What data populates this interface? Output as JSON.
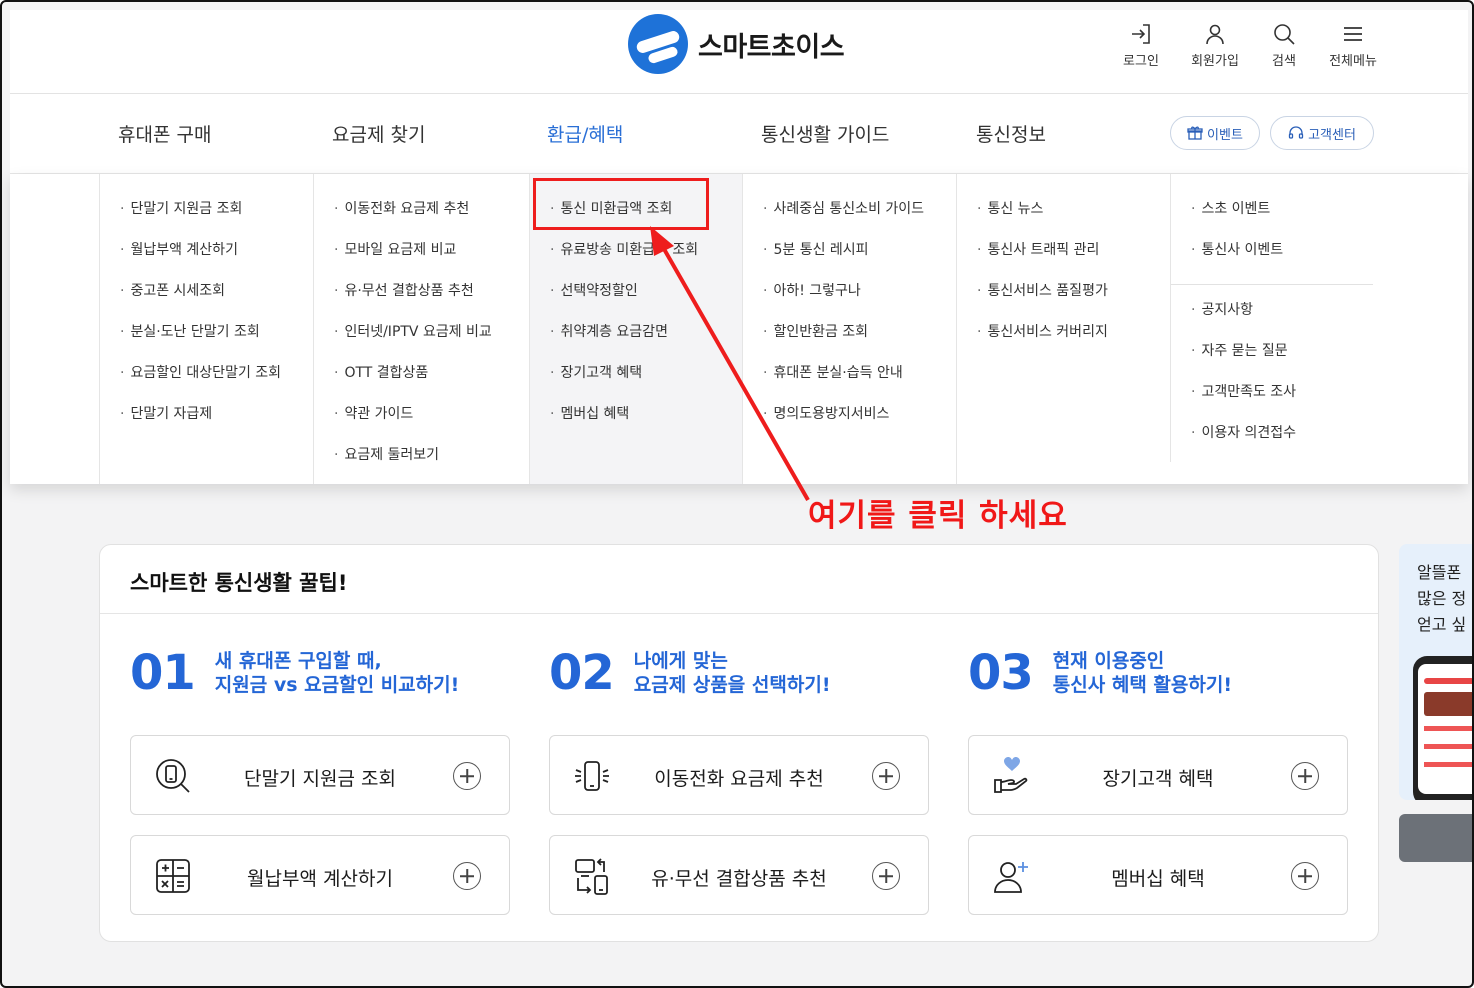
{
  "colors": {
    "accent": "#2466d6",
    "annotation": "#ee1d1d",
    "logo": "#1e72d8"
  },
  "header": {
    "logo_text": "스마트초이스",
    "utils": [
      {
        "label": "로그인",
        "icon": "login-icon"
      },
      {
        "label": "회원가입",
        "icon": "user-icon"
      },
      {
        "label": "검색",
        "icon": "search-icon"
      },
      {
        "label": "전체메뉴",
        "icon": "menu-icon"
      }
    ]
  },
  "gnb": {
    "items": [
      "휴대폰 구매",
      "요금제 찾기",
      "환급/혜택",
      "통신생활 가이드",
      "통신정보"
    ],
    "active": "환급/혜택",
    "event_label": "이벤트",
    "support_label": "고객센터"
  },
  "dropdown": {
    "col1": [
      "단말기 지원금 조회",
      "월납부액 계산하기",
      "중고폰 시세조회",
      "분실·도난 단말기 조회",
      "요금할인 대상단말기 조회",
      "단말기 자급제"
    ],
    "col2": [
      "이동전화 요금제 추천",
      "모바일 요금제 비교",
      "유·무선 결합상품 추천",
      "인터넷/IPTV 요금제 비교",
      "OTT 결합상품",
      "약관 가이드",
      "요금제 둘러보기"
    ],
    "col3": [
      "통신 미환급액 조회",
      "유료방송 미환급액 조회",
      "선택약정할인",
      "취약계층 요금감면",
      "장기고객 혜택",
      "멤버십 혜택"
    ],
    "col4": [
      "사례중심 통신소비 가이드",
      "5분 통신 레시피",
      "아하! 그렇구나",
      "할인반환금 조회",
      "휴대폰 분실·습득 안내",
      "명의도용방지서비스"
    ],
    "col5": [
      "통신 뉴스",
      "통신사 트래픽 관리",
      "통신서비스 품질평가",
      "통신서비스 커버리지"
    ],
    "col6a": [
      "스초 이벤트",
      "통신사 이벤트"
    ],
    "col6b": [
      "공지사항",
      "자주 묻는 질문",
      "고객만족도 조사",
      "이용자 의견접수"
    ]
  },
  "annotation": {
    "text": "여기를 클릭 하세요"
  },
  "tips": {
    "title": "스마트한 통신생활 꿀팁!",
    "groups": [
      {
        "num": "01",
        "line1": "새 휴대폰 구입할 때,",
        "line2": "지원금 vs 요금할인 비교하기!",
        "buttons": [
          {
            "label": "단말기 지원금 조회",
            "icon": "phone-search-icon"
          },
          {
            "label": "월납부액 계산하기",
            "icon": "calculator-icon"
          }
        ]
      },
      {
        "num": "02",
        "line1": "나에게 맞는",
        "line2": "요금제 상품을 선택하기!",
        "buttons": [
          {
            "label": "이동전화 요금제 추천",
            "icon": "phone-signal-icon"
          },
          {
            "label": "유·무선 결합상품 추천",
            "icon": "device-combo-icon"
          }
        ]
      },
      {
        "num": "03",
        "line1": "현재 이용중인",
        "line2": "통신사 혜택 활용하기!",
        "buttons": [
          {
            "label": "장기고객 혜택",
            "icon": "heart-hand-icon"
          },
          {
            "label": "멤버십 혜택",
            "icon": "user-add-icon"
          }
        ]
      }
    ]
  },
  "side_banner": {
    "lines": [
      "알뜰폰",
      "많은 정",
      "얻고 싶"
    ]
  }
}
